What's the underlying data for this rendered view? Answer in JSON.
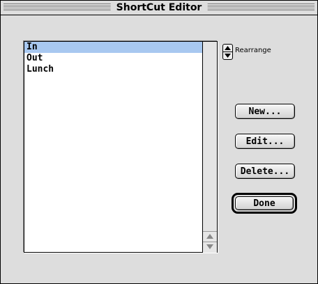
{
  "window": {
    "title": "ShortCut Editor"
  },
  "list": {
    "items": [
      "In",
      "Out",
      "Lunch"
    ],
    "selected_index": 0
  },
  "rearrange": {
    "label": "Rearrange"
  },
  "buttons": {
    "new_label": "New...",
    "edit_label": "Edit...",
    "delete_label": "Delete...",
    "done_label": "Done"
  },
  "icons": {
    "stepper": "up-down-stepper-icon",
    "scroll_up": "scroll-up-arrow-icon",
    "scroll_down": "scroll-down-arrow-icon"
  },
  "colors": {
    "selection": "#a8c8f0",
    "window_bg": "#dddddd"
  }
}
